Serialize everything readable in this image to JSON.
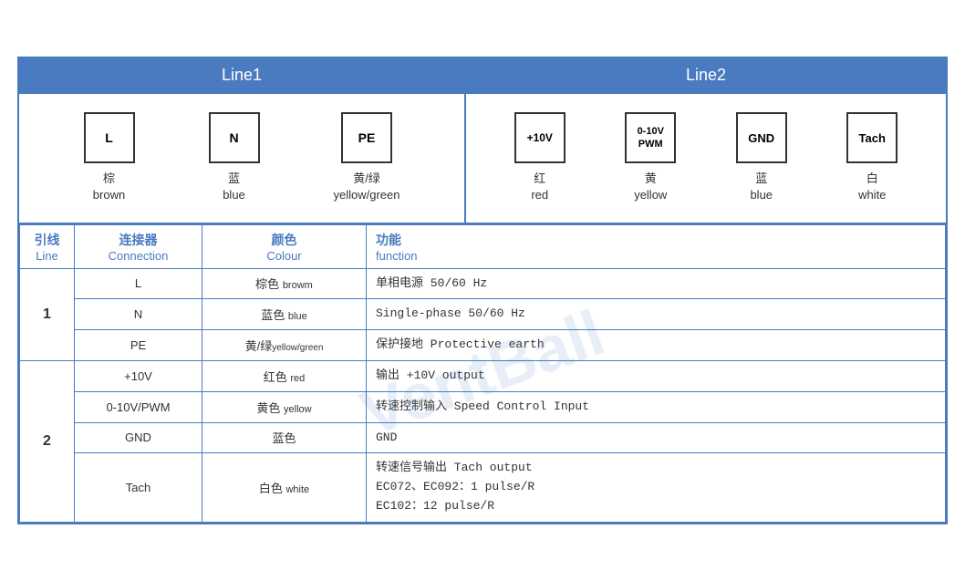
{
  "header": {
    "line1_label": "Line1",
    "line2_label": "Line2"
  },
  "diagram": {
    "line1_connectors": [
      {
        "symbol": "L",
        "cn": "棕",
        "en": "brown"
      },
      {
        "symbol": "N",
        "cn": "蓝",
        "en": "blue"
      },
      {
        "symbol": "PE",
        "cn": "黄/绿",
        "en": "yellow/green"
      }
    ],
    "line2_connectors": [
      {
        "symbol": "+10V",
        "cn": "红",
        "en": "red"
      },
      {
        "symbol": "0-10V\nPWM",
        "cn": "黄",
        "en": "yellow"
      },
      {
        "symbol": "GND",
        "cn": "蓝",
        "en": "blue"
      },
      {
        "symbol": "Tach",
        "cn": "白",
        "en": "white"
      }
    ]
  },
  "table": {
    "headers": {
      "line_cn": "引线",
      "line_en": "Line",
      "conn_cn": "连接器",
      "conn_en": "Connection",
      "colour_cn": "颜色",
      "colour_en": "Colour",
      "func_cn": "功能",
      "func_en": "function"
    },
    "rows": [
      {
        "line": "1",
        "rowspan": 3,
        "entries": [
          {
            "conn": "L",
            "colour_cn": "棕色",
            "colour_en": "browm",
            "func": "单相电源 50/60 Hz"
          },
          {
            "conn": "N",
            "colour_cn": "蓝色",
            "colour_en": "blue",
            "func": "Single-phase 50/60 Hz"
          },
          {
            "conn": "PE",
            "colour_cn": "黄/绿",
            "colour_en": "yellow/green",
            "func": "保护接地 Protective earth"
          }
        ]
      },
      {
        "line": "2",
        "rowspan": 4,
        "entries": [
          {
            "conn": "+10V",
            "colour_cn": "红色",
            "colour_en": "red",
            "func": "输出 +10V output"
          },
          {
            "conn": "0-10V/PWM",
            "colour_cn": "黄色",
            "colour_en": "yellow",
            "func": "转速控制输入 Speed Control Input"
          },
          {
            "conn": "GND",
            "colour_cn": "蓝色",
            "colour_en": "",
            "func": "GND"
          },
          {
            "conn": "Tach",
            "colour_cn": "白色",
            "colour_en": "white",
            "func": "转速信号输出 Tach output\nEC072、EC092：1 pulse/R\nEC102：12 pulse/R"
          }
        ]
      }
    ]
  },
  "watermark": "VentBall"
}
